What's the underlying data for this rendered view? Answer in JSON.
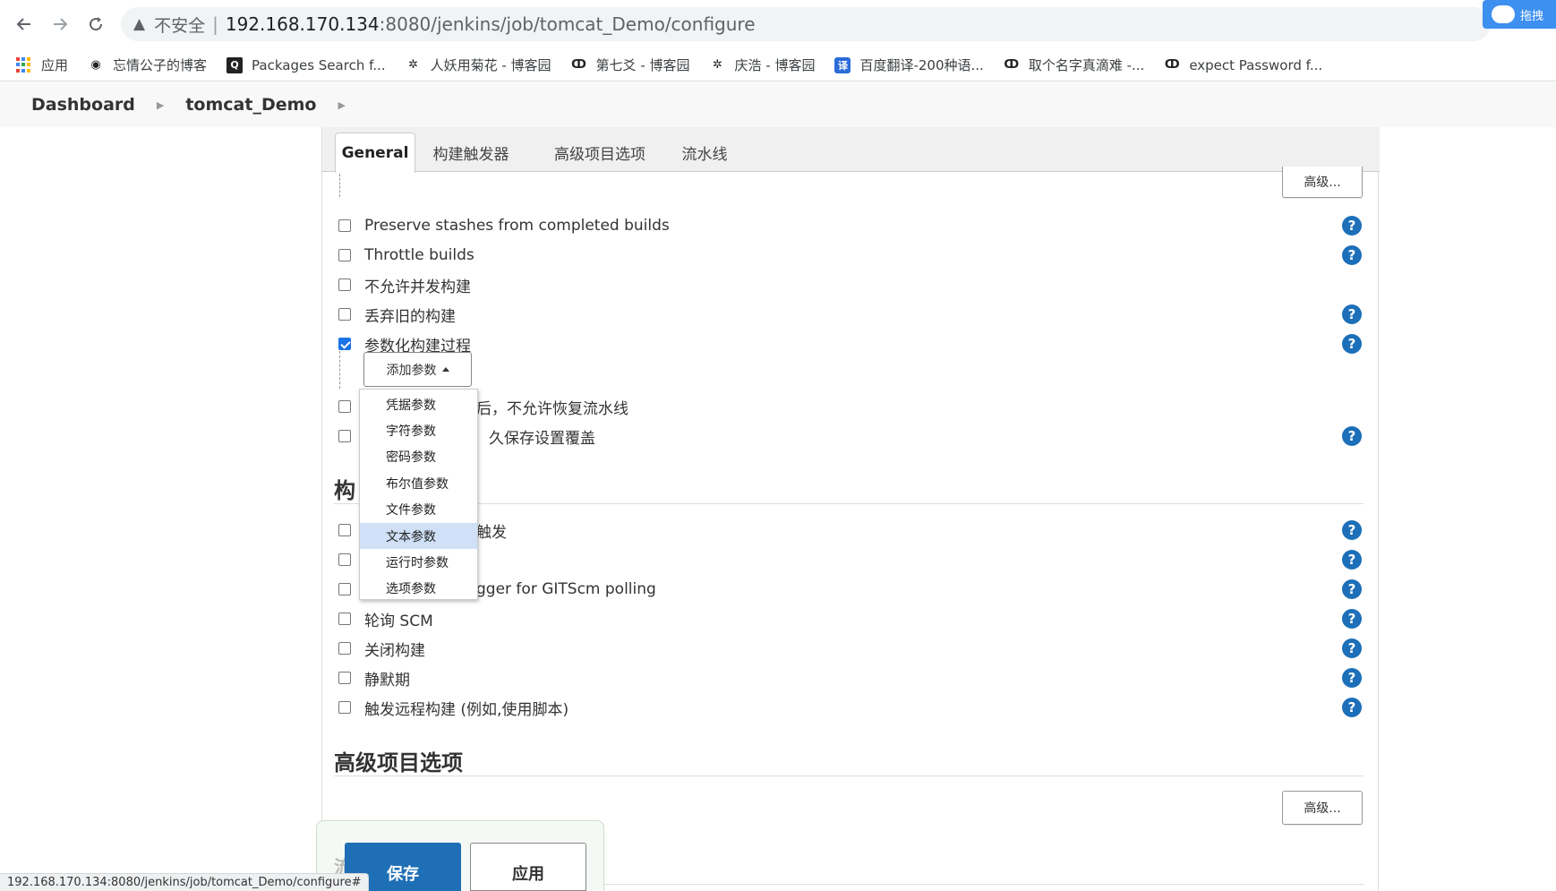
{
  "browser": {
    "insecure_label": "不安全",
    "url_host": "192.168.170.134",
    "url_path": ":8080/jenkins/job/tomcat_Demo/configure",
    "extension_label": "拖拽",
    "bookmarks": [
      {
        "label": "应用",
        "icon": "apps-grid-icon"
      },
      {
        "label": "忘情公子的博客",
        "icon": "globe-icon"
      },
      {
        "label": "Packages Search f...",
        "icon": "search-box-icon"
      },
      {
        "label": "人妖用菊花 - 博客园",
        "icon": "cnblogs-icon"
      },
      {
        "label": "第七爻 - 博客园",
        "icon": "cnblogs-bird-icon"
      },
      {
        "label": "庆浩 - 博客园",
        "icon": "cnblogs-icon"
      },
      {
        "label": "百度翻译-200种语...",
        "icon": "baidu-translate-icon"
      },
      {
        "label": "取个名字真滴难 -...",
        "icon": "cnblogs-bird-icon"
      },
      {
        "label": "expect Password f...",
        "icon": "cnblogs-bird-icon"
      }
    ]
  },
  "breadcrumb": {
    "items": [
      "Dashboard",
      "tomcat_Demo"
    ]
  },
  "tabs": [
    "General",
    "构建触发器",
    "高级项目选项",
    "流水线"
  ],
  "advanced_label": "高级...",
  "general": {
    "options": [
      {
        "label": "Preserve stashes from completed builds",
        "checked": false
      },
      {
        "label": "Throttle builds",
        "checked": false
      },
      {
        "label": "不允许并发构建",
        "checked": false
      },
      {
        "label": "丢弃旧的构建",
        "checked": false
      },
      {
        "label": "参数化构建过程",
        "checked": true
      }
    ],
    "add_param_label": "添加参数",
    "partial_options": [
      {
        "label": "后，不允许恢复流水线",
        "checked": false
      },
      {
        "label": "久保存设置覆盖",
        "checked": false
      }
    ]
  },
  "param_menu": [
    "凭据参数",
    "字符参数",
    "密码参数",
    "布尔值参数",
    "文件参数",
    "文本参数",
    "运行时参数",
    "选项参数"
  ],
  "param_menu_highlighted": "文本参数",
  "triggers": {
    "title_partial": "构",
    "options": [
      {
        "label": "触发",
        "checked": false
      },
      {
        "label": "",
        "checked": false
      },
      {
        "label": "gger for GITScm polling",
        "checked": false
      },
      {
        "label": "轮询 SCM",
        "checked": false
      },
      {
        "label": "关闭构建",
        "checked": false
      },
      {
        "label": "静默期",
        "checked": false
      },
      {
        "label": "触发远程构建 (例如,使用脚本)",
        "checked": false
      }
    ]
  },
  "advanced_options": {
    "title": "高级项目选项"
  },
  "pipeline_partial": "流",
  "buttons": {
    "save": "保存",
    "apply": "应用"
  },
  "status_url": "192.168.170.134:8080/jenkins/job/tomcat_Demo/configure#"
}
